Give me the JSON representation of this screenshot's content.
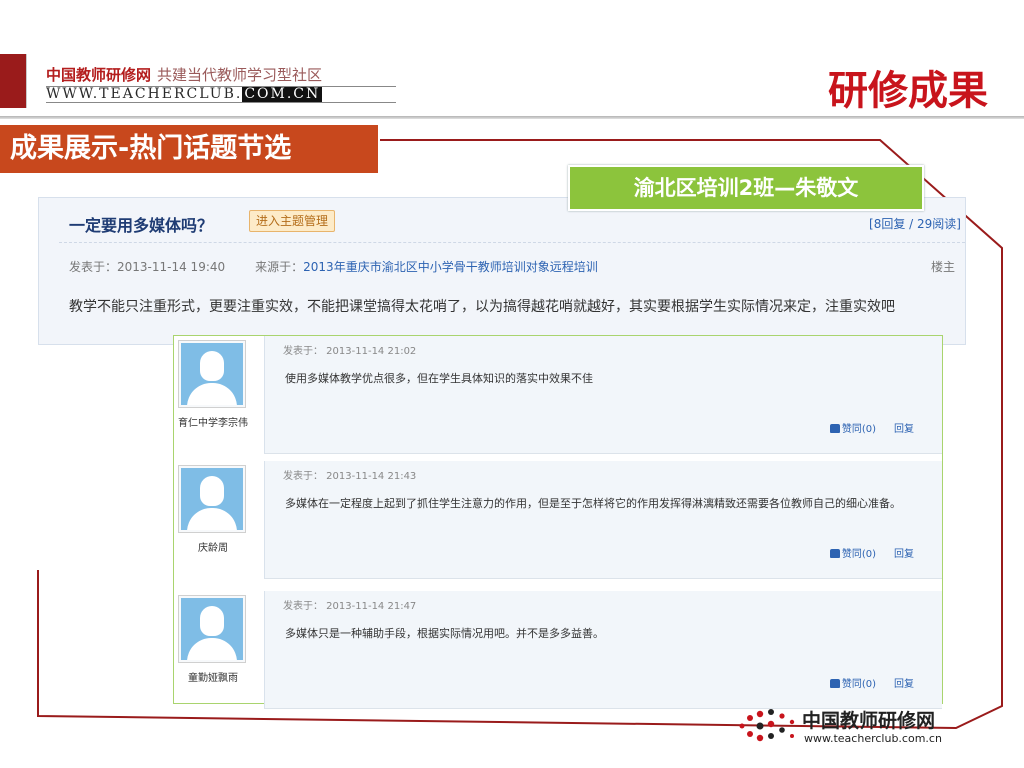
{
  "header": {
    "logo_cn": "中国教师研修网",
    "slogan": "共建当代教师学习型社区",
    "logo_url_main": "WWW.TEACHERCLUB.",
    "logo_url_tail": "COM.CN",
    "page_title": "研修成果"
  },
  "section": {
    "tag": "成果展示-热门话题节选",
    "author_tag": "渝北区培训2班—朱敬文"
  },
  "thread": {
    "title": "一定要用多媒体吗？",
    "manage_button": "进入主题管理",
    "reply_count": "[8回复 / 29阅读]",
    "posted_label": "发表于：2013-11-14 19:40",
    "source_label": "来源于：",
    "source_link": "2013年重庆市渝北区中小学骨干教师培训对象远程培训",
    "floor": "楼主",
    "body": "教学不能只注重形式，更要注重实效，不能把课堂搞得太花哨了，以为搞得越花哨就越好，其实要根据学生实际情况来定，注重实效吧"
  },
  "replies": [
    {
      "name": "育仁中学李宗伟",
      "time": "发表于： 2013-11-14 21:02",
      "text": "使用多媒体教学优点很多，但在学生具体知识的落实中效果不佳",
      "like": "赞同(0)",
      "reply": "回复"
    },
    {
      "name": "庆龄周",
      "time": "发表于： 2013-11-14 21:43",
      "text": "多媒体在一定程度上起到了抓住学生注意力的作用，但是至于怎样将它的作用发挥得淋漓精致还需要各位教师自己的细心准备。",
      "like": "赞同(0)",
      "reply": "回复"
    },
    {
      "name": "童勤娅飘雨",
      "time": "发表于： 2013-11-14 21:47",
      "text": "多媒体只是一种辅助手段，根据实际情况用吧。并不是多多益善。",
      "like": "赞同(0)",
      "reply": "回复"
    }
  ],
  "footer": {
    "cn": "中国教师研修网",
    "url": "www.teacherclub.com.cn"
  },
  "colors": {
    "brand_red": "#c8141c",
    "frame_red": "#9a1b1b",
    "section_orange": "#c8481d",
    "author_green": "#8cc43c",
    "link_blue": "#2d63b2"
  }
}
